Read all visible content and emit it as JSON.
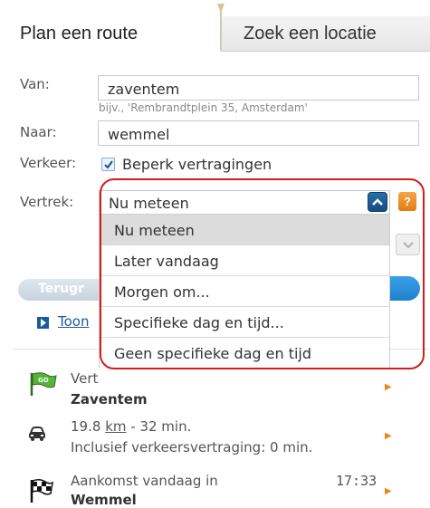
{
  "tabs": {
    "active": "Plan een route",
    "inactive": "Zoek een locatie"
  },
  "form": {
    "van_label": "Van:",
    "van_value": "zaventem",
    "van_hint": "bijv., 'Rembrandtplein 35, Amsterdam'",
    "naar_label": "Naar:",
    "naar_value": "wemmel",
    "verkeer_label": "Verkeer:",
    "verkeer_checkbox_label": "Beperk vertragingen",
    "verkeer_checked": true,
    "vertrek_label": "Vertrek:",
    "vertrek_selected": "Nu meteen",
    "help_label": "?"
  },
  "dropdown": {
    "options": [
      "Nu meteen",
      "Later vandaag",
      "Morgen om...",
      "Specifieke dag en tijd...",
      "Geen specifieke dag en tijd"
    ],
    "selected_index": 0
  },
  "buttons": {
    "back": "Terugr"
  },
  "links": {
    "toon": "Toon"
  },
  "route": {
    "start_prefix": "Vert",
    "start_name": "Zaventem",
    "distance": "19.8",
    "distance_unit": "km",
    "duration": " - 32 min.",
    "traffic_delay": "Inclusief verkeersvertraging: 0 min.",
    "arrival_label": "Aankomst vandaag in",
    "arrival_time": "17:33",
    "destination_name": "Wemmel",
    "start_flag_text": "GO"
  },
  "colors": {
    "highlight": "#d41c1c",
    "accent_orange": "#e78a1c",
    "link_blue": "#1a5aa0",
    "selected_gray": "#dcdcdc"
  },
  "icons": [
    "green-go-flag-icon",
    "car-icon",
    "checkered-flag-icon",
    "chevron-up-icon",
    "chevron-down-icon",
    "help-icon",
    "arrow-right-icon"
  ]
}
